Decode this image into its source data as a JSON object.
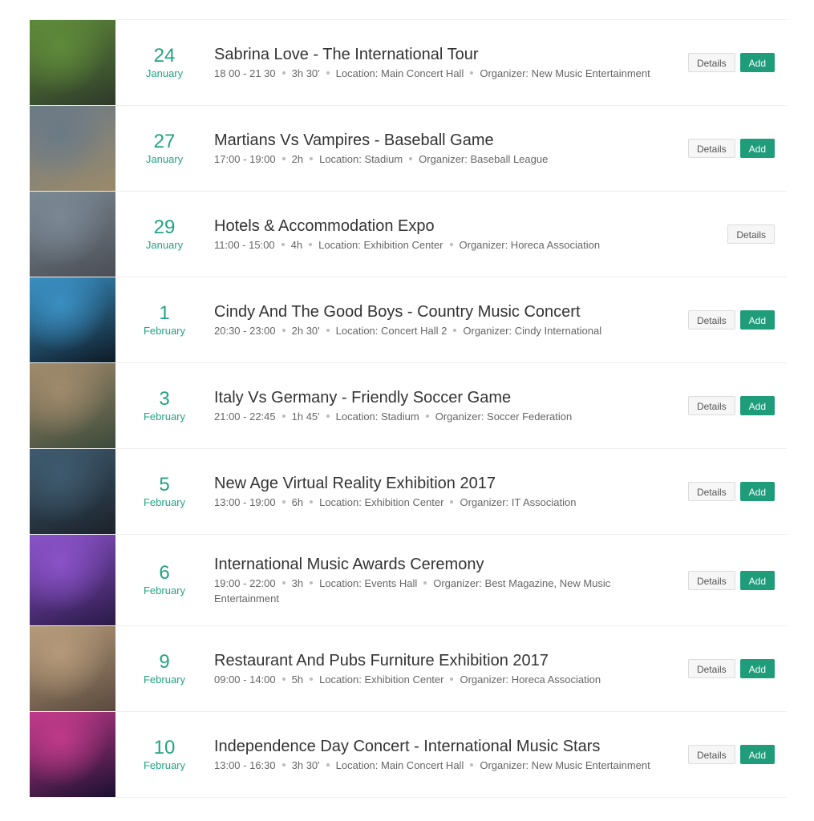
{
  "buttons": {
    "details_label": "Details",
    "add_label": "Add"
  },
  "events": [
    {
      "day": "24",
      "month": "January",
      "title": "Sabrina Love - The International Tour",
      "time": "18 00 - 21 30",
      "duration": "3h 30'",
      "location": "Location: Main Concert Hall",
      "organizer": "Organizer: New Music Entertainment",
      "has_add": true,
      "image": "concert-singer-photo",
      "colors": [
        "#5f8a3a",
        "#2e3a2a"
      ]
    },
    {
      "day": "27",
      "month": "January",
      "title": "Martians Vs Vampires - Baseball Game",
      "time": "17:00 - 19:00",
      "duration": "2h",
      "location": "Location: Stadium",
      "organizer": "Organizer: Baseball League",
      "has_add": true,
      "image": "baseball-stadium-photo",
      "colors": [
        "#6b7a86",
        "#9b8a6a"
      ]
    },
    {
      "day": "29",
      "month": "January",
      "title": "Hotels & Accommodation Expo",
      "time": "11:00 - 15:00",
      "duration": "4h",
      "location": "Location: Exhibition Center",
      "organizer": "Organizer: Horeca Association",
      "has_add": false,
      "image": "expo-hall-photo",
      "colors": [
        "#7a8894",
        "#4b4e55"
      ]
    },
    {
      "day": "1",
      "month": "February",
      "title": "Cindy And The Good Boys - Country Music Concert",
      "time": "20:30 - 23:00",
      "duration": "2h 30'",
      "location": "Location: Concert Hall 2",
      "organizer": "Organizer: Cindy International",
      "has_add": true,
      "image": "concert-crowd-photo",
      "colors": [
        "#3a8fc2",
        "#0e1a25"
      ]
    },
    {
      "day": "3",
      "month": "February",
      "title": "Italy Vs Germany - Friendly Soccer Game",
      "time": "21:00 - 22:45",
      "duration": "1h 45'",
      "location": "Location: Stadium",
      "organizer": "Organizer: Soccer Federation",
      "has_add": true,
      "image": "soccer-stadium-aerial-photo",
      "colors": [
        "#a08a6c",
        "#3c4a3a"
      ]
    },
    {
      "day": "5",
      "month": "February",
      "title": "New Age Virtual Reality Exhibition 2017",
      "time": "13:00 - 19:00",
      "duration": "6h",
      "location": "Location: Exhibition Center",
      "organizer": "Organizer: IT Association",
      "has_add": true,
      "image": "vr-exhibition-photo",
      "colors": [
        "#3e5a6e",
        "#1b222a"
      ]
    },
    {
      "day": "6",
      "month": "February",
      "title": "International Music Awards Ceremony",
      "time": "19:00 - 22:00",
      "duration": "3h",
      "location": "Location: Events Hall",
      "organizer": "Organizer: Best Magazine, New Music Entertainment",
      "has_add": true,
      "image": "dj-mixer-photo",
      "colors": [
        "#8a52c8",
        "#2a1a48"
      ]
    },
    {
      "day": "9",
      "month": "February",
      "title": "Restaurant And Pubs Furniture Exhibition 2017",
      "time": "09:00 - 14:00",
      "duration": "5h",
      "location": "Location: Exhibition Center",
      "organizer": "Organizer: Horeca Association",
      "has_add": true,
      "image": "exhibition-hall-photo",
      "colors": [
        "#b59a7a",
        "#5a4a3e"
      ]
    },
    {
      "day": "10",
      "month": "February",
      "title": "Independence Day Concert - International Music Stars",
      "time": "13:00 - 16:30",
      "duration": "3h 30'",
      "location": "Location: Main Concert Hall",
      "organizer": "Organizer: New Music Entertainment",
      "has_add": true,
      "image": "stage-lights-photo",
      "colors": [
        "#c03a8a",
        "#1a1030"
      ]
    }
  ]
}
